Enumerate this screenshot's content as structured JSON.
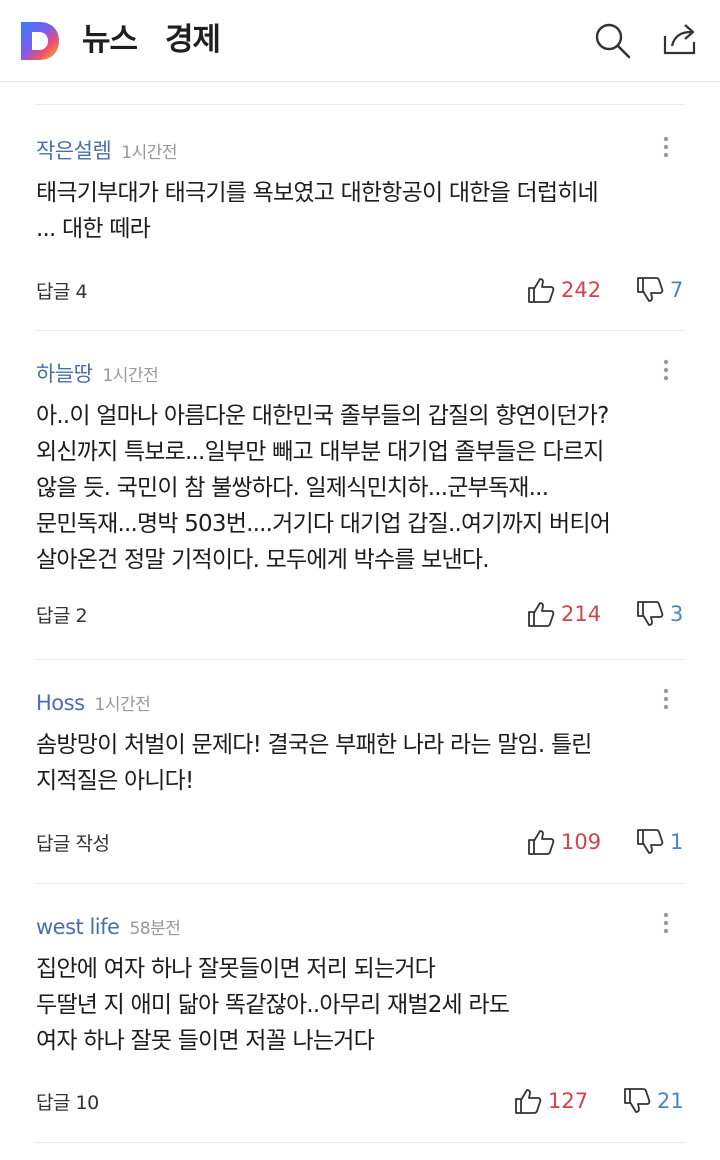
{
  "header": {
    "logo_icon": "daum-d-logo-icon",
    "news_label": "뉴스",
    "section_label": "경제",
    "search_icon": "search-icon",
    "share_icon": "share-icon"
  },
  "colors": {
    "username": "#4a6fa8",
    "like": "#d2434b",
    "dislike": "#4a86c5",
    "divider": "#ececec"
  },
  "comments": [
    {
      "user": "작은설렘",
      "time": "1시간전",
      "text": "태극기부대가 태극기를 욕보였고 대한항공이 대한을  더럽히네\n...  대한 떼라",
      "reply": "답글 4",
      "likes": "242",
      "dislikes": "7"
    },
    {
      "user": "하늘땅",
      "time": "1시간전",
      "text": "아..이 얼마나 아름다운 대한민국 졸부들의 갑질의 향연이던가?\n외신까지 특보로...일부만 빼고 대부분 대기업 졸부들은 다르지\n않을 듯. 국민이 참 불쌍하다. 일제식민치하...군부독재...\n문민독재...명박 503번....거기다 대기업 갑질..여기까지 버티어\n살아온건 정말 기적이다. 모두에게 박수를 보낸다.",
      "reply": "답글 2",
      "likes": "214",
      "dislikes": "3"
    },
    {
      "user": "Hoss",
      "time": "1시간전",
      "text": "솜방망이 처벌이 문제다! 결국은 부패한 나라 라는 말임. 틀린\n지적질은 아니다!",
      "reply": "답글 작성",
      "likes": "109",
      "dislikes": "1"
    },
    {
      "user": "west life",
      "time": "58분전",
      "text": "집안에 여자 하나 잘못들이면 저리 되는거다\n두딸년 지 애미 닮아 똑같잖아..아무리 재벌2세 라도\n여자 하나 잘못 들이면 저꼴 나는거다",
      "reply": "답글 10",
      "likes": "127",
      "dislikes": "21"
    }
  ]
}
